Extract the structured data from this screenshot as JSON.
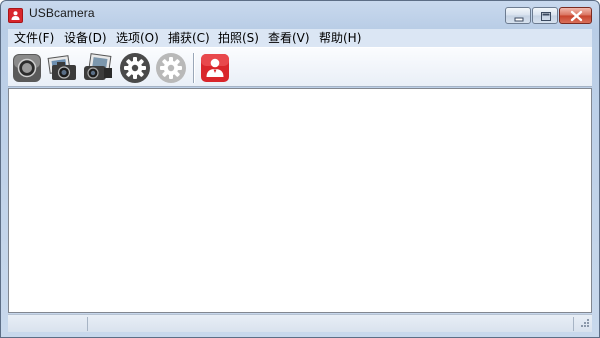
{
  "window": {
    "title": "USBcamera",
    "app_icon": "usb-camera-app-icon",
    "caption_buttons": [
      "minimize",
      "maximize",
      "close"
    ]
  },
  "menu": {
    "items": [
      {
        "label": "文件(F)"
      },
      {
        "label": "设备(D)"
      },
      {
        "label": "选项(O)"
      },
      {
        "label": "捕获(C)"
      },
      {
        "label": "拍照(S)"
      },
      {
        "label": "查看(V)"
      },
      {
        "label": "帮助(H)"
      }
    ]
  },
  "toolbar": {
    "buttons": [
      {
        "icon": "record-icon"
      },
      {
        "icon": "photo-camera-icon"
      },
      {
        "icon": "video-camera-icon"
      },
      {
        "icon": "settings-gear-icon"
      },
      {
        "icon": "settings-gear-disabled-icon"
      },
      {
        "icon": "user-profile-icon"
      }
    ]
  },
  "statusbar": {
    "panes": [
      "",
      ""
    ]
  },
  "colors": {
    "title_bar": "#c9d9ee",
    "close_button": "#c7422b",
    "accent_red": "#d8262c",
    "canvas": "#ffffff"
  }
}
